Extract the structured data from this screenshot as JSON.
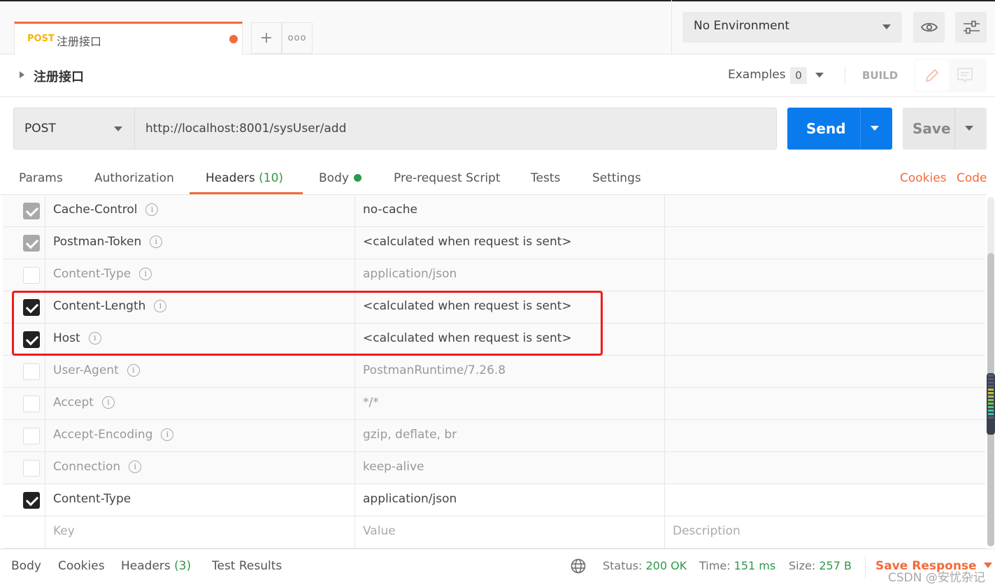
{
  "tabs": [
    {
      "method": "POST",
      "name": "注册接口",
      "unsaved": true
    }
  ],
  "tab_actions": {
    "new_tab": "+",
    "more": "ooo"
  },
  "environment": {
    "selected": "No Environment"
  },
  "request": {
    "title": "注册接口",
    "examples_label": "Examples",
    "examples_count": "0",
    "build_label": "BUILD",
    "method": "POST",
    "url": "http://localhost:8001/sysUser/add",
    "send_label": "Send",
    "save_label": "Save"
  },
  "request_tabs": {
    "params": "Params",
    "authorization": "Authorization",
    "headers": "Headers",
    "headers_count": "(10)",
    "body": "Body",
    "prerequest": "Pre-request Script",
    "tests": "Tests",
    "settings": "Settings",
    "cookies": "Cookies",
    "code": "Code",
    "active": "Headers"
  },
  "headers": [
    {
      "key": "Cache-Control",
      "value": "no-cache",
      "checked": true,
      "auto": true
    },
    {
      "key": "Postman-Token",
      "value": "<calculated when request is sent>",
      "checked": true,
      "auto": true
    },
    {
      "key": "Content-Type",
      "value": "application/json",
      "checked": false,
      "auto": true
    },
    {
      "key": "Content-Length",
      "value": "<calculated when request is sent>",
      "checked": true,
      "auto": true
    },
    {
      "key": "Host",
      "value": "<calculated when request is sent>",
      "checked": true,
      "auto": true
    },
    {
      "key": "User-Agent",
      "value": "PostmanRuntime/7.26.8",
      "checked": false,
      "auto": true
    },
    {
      "key": "Accept",
      "value": "*/*",
      "checked": false,
      "auto": true
    },
    {
      "key": "Accept-Encoding",
      "value": "gzip, deflate, br",
      "checked": false,
      "auto": true
    },
    {
      "key": "Connection",
      "value": "keep-alive",
      "checked": false,
      "auto": true
    },
    {
      "key": "Content-Type",
      "value": "application/json",
      "checked": true,
      "auto": false
    }
  ],
  "new_header": {
    "key_placeholder": "Key",
    "value_placeholder": "Value",
    "description_placeholder": "Description"
  },
  "response_bar": {
    "body": "Body",
    "cookies": "Cookies",
    "headers": "Headers",
    "headers_count": "(3)",
    "test_results": "Test Results",
    "status_label": "Status:",
    "status": "200 OK",
    "time_label": "Time:",
    "time": "151 ms",
    "size_label": "Size:",
    "size": "257 B",
    "save_response": "Save Response"
  },
  "watermark": "CSDN @安忧杂记",
  "colors": {
    "accent": "#f26b3a",
    "send": "#097bed",
    "success": "#2c9a4a",
    "highlight": "#f21b1b",
    "method_tab": "#f4b400"
  }
}
